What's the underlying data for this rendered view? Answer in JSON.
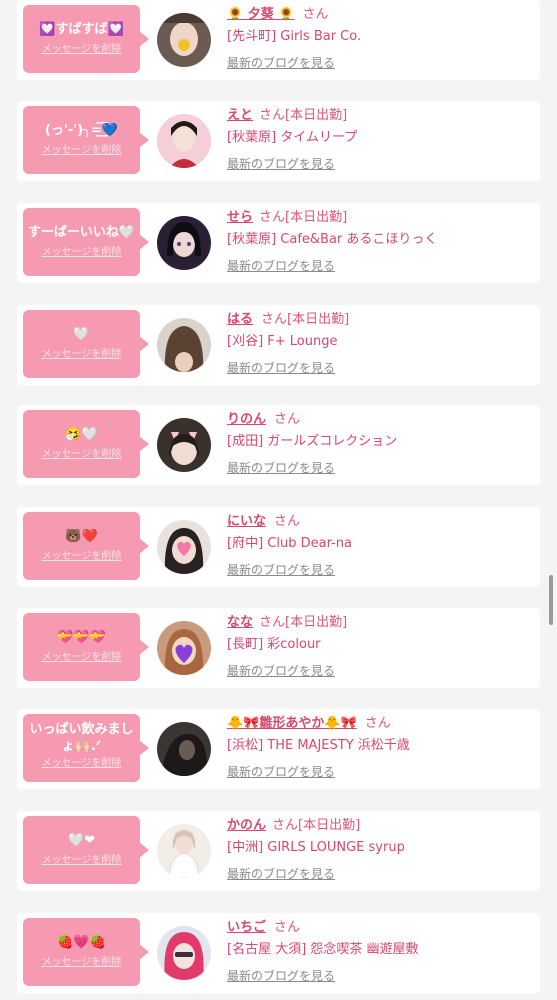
{
  "delete_label": "メッセージを削除",
  "blog_label": "最新のブログを見る",
  "san": "さん",
  "today_label": "[本日出勤]",
  "colors": {
    "bubble": "#f59ab0",
    "accent": "#d9466e",
    "muted": "#8a8a8a"
  },
  "items": [
    {
      "message": "💟すばすば💟",
      "name": "🌻 夕葵 🌻",
      "today": false,
      "shop": "[先斗町] Girls Bar Co.",
      "avatar": "avatar-1"
    },
    {
      "message": "(っ'-')╮=͟͟͞͞💙",
      "name": "えと",
      "today": true,
      "shop": "[秋葉原] タイムリープ",
      "avatar": "avatar-2"
    },
    {
      "message": "すーばーいいね🤍",
      "name": "せら",
      "today": true,
      "shop": "[秋葉原] Cafe&Bar あるこほりっく",
      "avatar": "avatar-3"
    },
    {
      "message": "🤍",
      "name": "はる",
      "today": true,
      "shop": "[刈谷] F+ Lounge",
      "avatar": "avatar-4"
    },
    {
      "message": "🤧🤍",
      "name": "りのん",
      "today": false,
      "shop": "[成田] ガールズコレクション",
      "avatar": "avatar-5"
    },
    {
      "message": "🐻❤️",
      "name": "にいな",
      "today": false,
      "shop": "[府中] Club Dear-na",
      "avatar": "avatar-6"
    },
    {
      "message": "💝💝💝",
      "name": "なな",
      "today": true,
      "shop": "[長町] 彩colour",
      "avatar": "avatar-7"
    },
    {
      "message": "いっぱい飲みましょ🙌🏻.ᐟ",
      "name": "🐥🎀雛形あやか🐥🎀",
      "today": false,
      "shop": "[浜松] THE MAJESTY 浜松千歳",
      "avatar": "avatar-8"
    },
    {
      "message": "🤍❤",
      "name": "かのん",
      "today": true,
      "shop": "[中洲] GIRLS LOUNGE syrup",
      "avatar": "avatar-9"
    },
    {
      "message": "🍓💗🍓",
      "name": "いちご",
      "today": false,
      "shop": "[名古屋 大須] 怨念喫茶 幽遊屋敷",
      "avatar": "avatar-10"
    }
  ]
}
